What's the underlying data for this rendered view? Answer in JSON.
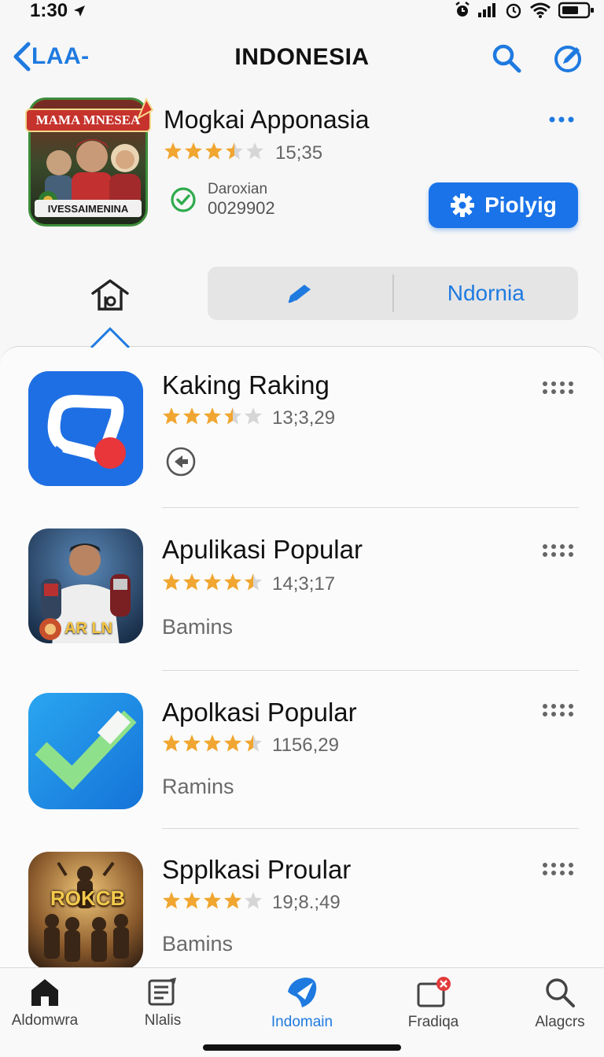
{
  "status": {
    "time": "1:30"
  },
  "nav": {
    "back_label": "LAA-",
    "title": "INDONESIA"
  },
  "featured": {
    "banner_text": "MAMA MNESEA",
    "caption_text": "IVESSAIMENINA",
    "title": "Mogkai Apponasia",
    "rating": 3.5,
    "rating_text": "15;35",
    "developer_label": "Daroxian",
    "developer_code": "0029902",
    "cta_label": "Piolyig"
  },
  "segmented": {
    "right_label": "Ndornia"
  },
  "apps": [
    {
      "title": "Kaking Raking",
      "rating": 3.5,
      "rating_text": "13;3,29",
      "subtitle": ""
    },
    {
      "title": "Apulikasi Popular",
      "rating": 4.5,
      "rating_text": "14;3;17",
      "subtitle": "Bamins",
      "icon_text": "AR LN"
    },
    {
      "title": "Apolkasi Popular",
      "rating": 4.5,
      "rating_text": "1156,29",
      "subtitle": "Ramins"
    },
    {
      "title": "Spplkasi Proular",
      "rating": 4.0,
      "rating_text": "19;8.;49",
      "subtitle": "Bamins",
      "icon_text": "ROKCB"
    }
  ],
  "tabs": [
    {
      "label": "Aldomwra",
      "icon": "house-icon"
    },
    {
      "label": "Nlalis",
      "icon": "list-icon"
    },
    {
      "label": "Indomain",
      "icon": "compass-icon",
      "active": true
    },
    {
      "label": "Fradiqa",
      "icon": "notification-icon"
    },
    {
      "label": "Alagcrs",
      "icon": "search-icon"
    }
  ],
  "colors": {
    "accent": "#1f7ae0",
    "star": "#f0a630",
    "button": "#1a73e8"
  }
}
